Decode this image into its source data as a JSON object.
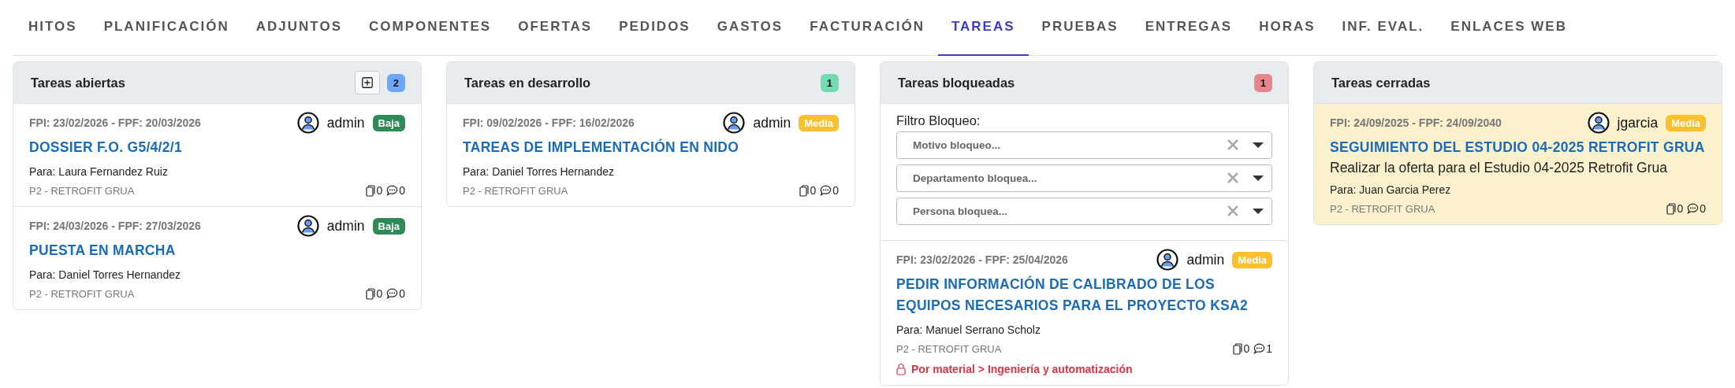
{
  "tabs": [
    {
      "label": "HITOS",
      "selected": false
    },
    {
      "label": "PLANIFICACIÓN",
      "selected": false
    },
    {
      "label": "ADJUNTOS",
      "selected": false
    },
    {
      "label": "COMPONENTES",
      "selected": false
    },
    {
      "label": "OFERTAS",
      "selected": false
    },
    {
      "label": "PEDIDOS",
      "selected": false
    },
    {
      "label": "GASTOS",
      "selected": false
    },
    {
      "label": "FACTURACIÓN",
      "selected": false
    },
    {
      "label": "TAREAS",
      "selected": true
    },
    {
      "label": "PRUEBAS",
      "selected": false
    },
    {
      "label": "ENTREGAS",
      "selected": false
    },
    {
      "label": "HORAS",
      "selected": false
    },
    {
      "label": "INF. EVAL.",
      "selected": false
    },
    {
      "label": "ENLACES WEB",
      "selected": false
    }
  ],
  "columns": [
    {
      "title": "Tareas abiertas",
      "add_button": true,
      "count": {
        "label": "2",
        "color": "#6ea8fe"
      },
      "tasks": [
        {
          "dates": "FPI: 23/02/2026 - FPF: 20/03/2026",
          "user": "admin",
          "priority": {
            "label": "Baja",
            "color": "#2e8b57"
          },
          "title": "DOSSIER F.O. G5/4/2/1",
          "recipient": "Para: Laura Fernandez Ruiz",
          "project": "P2 - RETROFIT GRUA",
          "attachments": "0",
          "comments": "0",
          "highlighted": false
        },
        {
          "dates": "FPI: 24/03/2026 - FPF: 27/03/2026",
          "user": "admin",
          "priority": {
            "label": "Baja",
            "color": "#2e8b57"
          },
          "title": "PUESTA EN MARCHA",
          "recipient": "Para: Daniel Torres Hernandez",
          "project": "P2 - RETROFIT GRUA",
          "attachments": "0",
          "comments": "0",
          "highlighted": false
        }
      ]
    },
    {
      "title": "Tareas en desarrollo",
      "add_button": false,
      "count": {
        "label": "1",
        "color": "#75d9b4"
      },
      "tasks": [
        {
          "dates": "FPI: 09/02/2026 - FPF: 16/02/2026",
          "user": "admin",
          "priority": {
            "label": "Media",
            "color": "#fbc02d"
          },
          "title": "TAREAS DE IMPLEMENTACIÓN EN NIDO",
          "recipient": "Para: Daniel Torres Hernandez",
          "project": "P2 - RETROFIT GRUA",
          "attachments": "0",
          "comments": "0",
          "highlighted": false
        }
      ]
    },
    {
      "title": "Tareas bloqueadas",
      "add_button": false,
      "count": {
        "label": "1",
        "color": "#e8848c"
      },
      "filter": {
        "label": "Filtro Bloqueo:",
        "fields": [
          {
            "placeholder": "Motivo bloqueo..."
          },
          {
            "placeholder": "Departamento bloquea..."
          },
          {
            "placeholder": "Persona bloquea..."
          }
        ]
      },
      "tasks": [
        {
          "dates": "FPI: 23/02/2026 - FPF: 25/04/2026",
          "user": "admin",
          "priority": {
            "label": "Media",
            "color": "#fbc02d"
          },
          "title": "PEDIR INFORMACIÓN DE CALIBRADO DE LOS EQUIPOS NECESARIOS PARA EL PROYECTO KSA2",
          "recipient": "Para: Manuel Serrano Scholz",
          "project": "P2 - RETROFIT GRUA",
          "attachments": "0",
          "comments": "1",
          "block_reason": "Por material > Ingeniería y automatización",
          "highlighted": false
        }
      ]
    },
    {
      "title": "Tareas cerradas",
      "add_button": false,
      "tasks": [
        {
          "dates": "FPI: 24/09/2025 - FPF: 24/09/2040",
          "user": "jgarcia",
          "priority": {
            "label": "Media",
            "color": "#fbc02d"
          },
          "title": "SEGUIMIENTO DEL ESTUDIO 04-2025 RETROFIT GRUA",
          "description": "Realizar la oferta para el Estudio 04-2025 Retrofit Grua",
          "recipient": "Para: Juan Garcia Perez",
          "project": "P2 - RETROFIT GRUA",
          "attachments": "0",
          "comments": "0",
          "highlighted": true
        }
      ]
    }
  ]
}
